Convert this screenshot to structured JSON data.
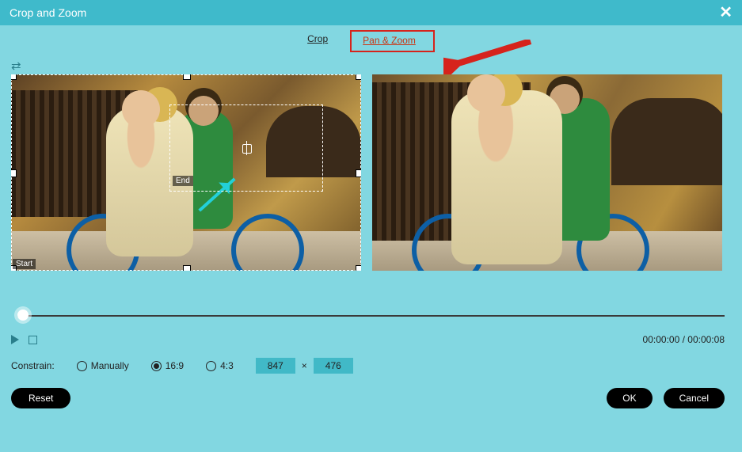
{
  "header": {
    "title": "Crop and Zoom"
  },
  "tabs": {
    "crop": "Crop",
    "pan_zoom": "Pan & Zoom"
  },
  "selection": {
    "start_label": "Start",
    "end_label": "End"
  },
  "time": {
    "current": "00:00:00",
    "total": "00:00:08",
    "sep": " / "
  },
  "constrain": {
    "label": "Constrain:",
    "manually": "Manually",
    "r16_9": "16:9",
    "r4_3": "4:3",
    "width": "847",
    "height": "476",
    "x": "×"
  },
  "buttons": {
    "reset": "Reset",
    "ok": "OK",
    "cancel": "Cancel"
  }
}
